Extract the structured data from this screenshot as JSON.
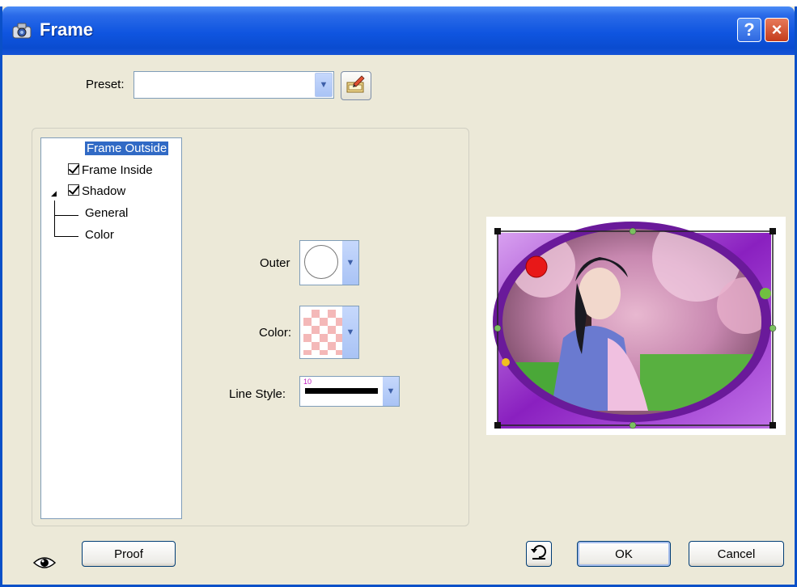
{
  "window": {
    "title": "Frame",
    "help_label": "?",
    "close_label": "×"
  },
  "preset": {
    "label": "Preset:",
    "value": ""
  },
  "tree": {
    "items": [
      {
        "label": "Frame Outside",
        "selected": true,
        "checked": false
      },
      {
        "label": "Frame Inside",
        "selected": false,
        "checked": true
      },
      {
        "label": "Shadow",
        "selected": false,
        "checked": true,
        "expanded": true
      },
      {
        "label": "General",
        "selected": false
      },
      {
        "label": "Color",
        "selected": false
      }
    ]
  },
  "settings": {
    "outer_label": "Outer",
    "color_label": "Color:",
    "line_style_label": "Line Style:",
    "line_width": "10"
  },
  "buttons": {
    "proof": "Proof",
    "ok": "OK",
    "cancel": "Cancel"
  },
  "colors": {
    "titlebar": "#0a4cd0",
    "dialog_bg": "#ece9d8",
    "selection": "#316ac5",
    "frame_purple": "#9b30c8"
  },
  "icons": {
    "title": "camera-app-icon",
    "preset_save": "save-preset-icon",
    "preview_toggle": "eye-icon",
    "reset": "reset-icon"
  }
}
